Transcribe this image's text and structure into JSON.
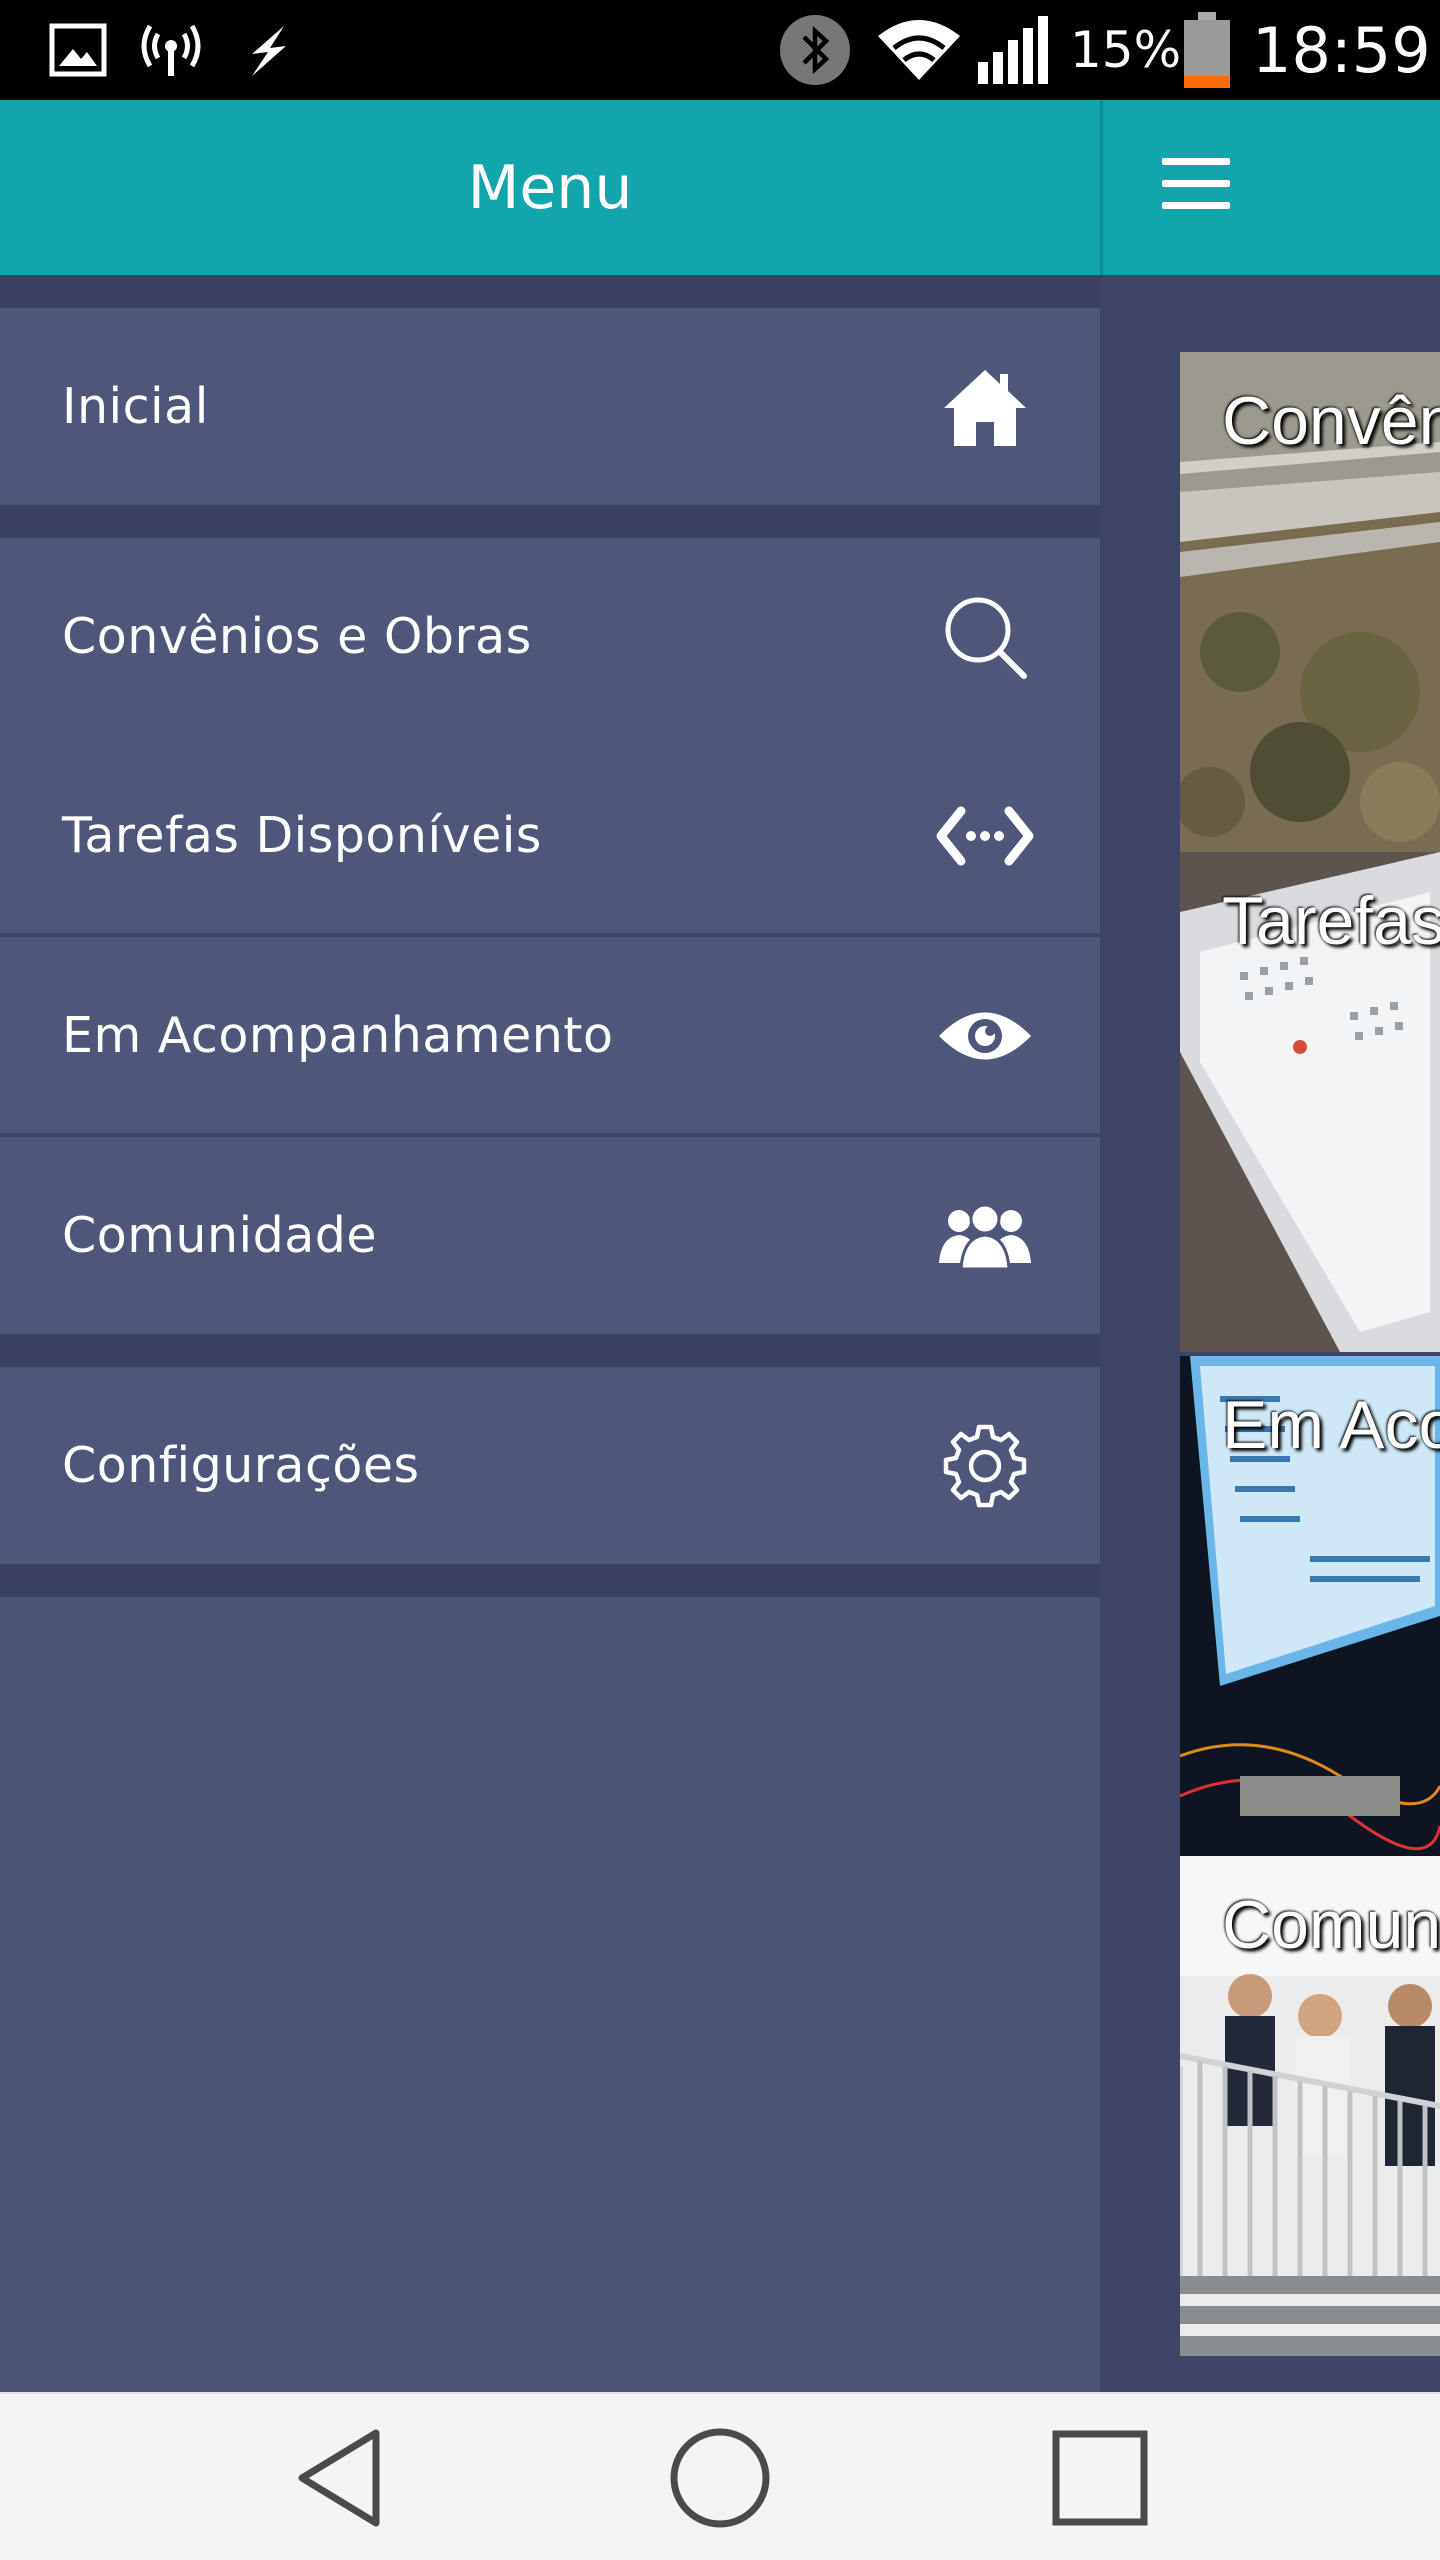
{
  "status_bar": {
    "battery_percent": "15%",
    "time": "18:59",
    "icons": [
      "image-icon",
      "wireless-hotspot-icon",
      "charging-icon",
      "bluetooth-icon",
      "wifi-icon",
      "signal-icon",
      "battery-icon"
    ]
  },
  "drawer": {
    "title": "Menu",
    "items": [
      {
        "label": "Inicial",
        "icon": "home-icon"
      },
      {
        "label": "Convênios e Obras",
        "icon": "search-icon"
      },
      {
        "label": "Tarefas Disponíveis",
        "icon": "code-arrows-icon"
      },
      {
        "label": "Em Acompanhamento",
        "icon": "eye-icon"
      },
      {
        "label": "Comunidade",
        "icon": "community-icon"
      },
      {
        "label": "Configurações",
        "icon": "gear-icon"
      }
    ]
  },
  "main": {
    "menu_icon": "hamburger-icon",
    "cards": [
      {
        "label": "Convên"
      },
      {
        "label": "Tarefas"
      },
      {
        "label": "Em Aco"
      },
      {
        "label": "Comun"
      }
    ]
  },
  "navbar": {
    "buttons": [
      "back-icon",
      "home-circle-icon",
      "recents-icon"
    ]
  },
  "colors": {
    "header": "#12a5ab",
    "drawer_item": "#4e5679",
    "drawer_gap": "#3a4162",
    "background": "#3d4466"
  }
}
